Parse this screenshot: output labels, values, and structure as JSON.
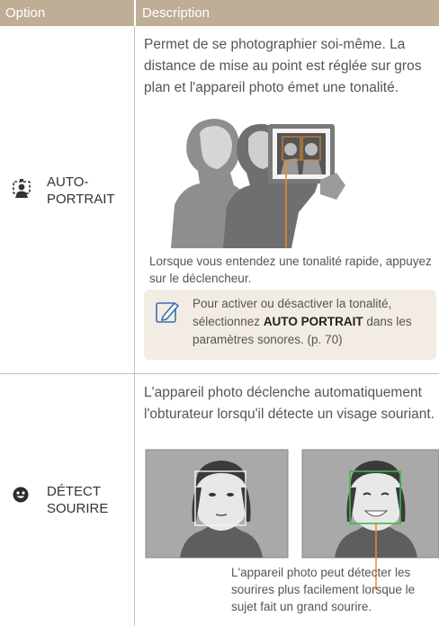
{
  "header": {
    "option": "Option",
    "description": "Description"
  },
  "rows": [
    {
      "option_line1": "AUTO-",
      "option_line2": "PORTRAIT",
      "icon": "self-portrait-icon",
      "description": "Permet de se photographier soi-même. La distance de mise au point est réglée sur gros plan et l'appareil photo émet une tonalité.",
      "caption": "Lorsque vous entendez une tonalité rapide, appuyez sur le déclencheur.",
      "note": {
        "icon": "pencil-note-icon",
        "before": "Pour activer ou désactiver la tonalité, sélectionnez ",
        "bold": "AUTO PORTRAIT",
        "after": " dans les paramètres sonores. (p. 70)"
      }
    },
    {
      "option_line1": "DÉTECT",
      "option_line2": "SOURIRE",
      "icon": "smile-face-icon",
      "description": "L'appareil photo déclenche automatiquement l'obturateur lorsqu'il détecte un visage souriant.",
      "caption": "L'appareil photo peut détecter les sourires plus facilement lorsque le sujet fait un grand sourire."
    }
  ],
  "colors": {
    "header": "#bfae96",
    "accent_line": "#f08a24",
    "face_box_green": "#3cb84a",
    "note_bg": "#f3ece4"
  }
}
